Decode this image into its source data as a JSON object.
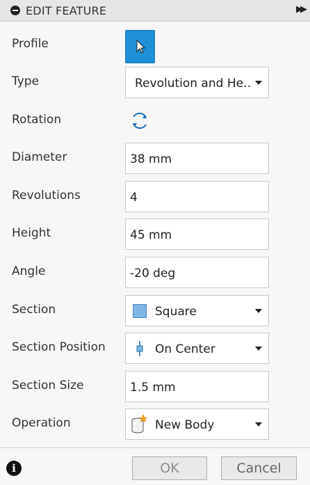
{
  "header": {
    "title": "EDIT FEATURE"
  },
  "fields": {
    "profile": {
      "label": "Profile"
    },
    "type": {
      "label": "Type",
      "value": "Revolution and He..."
    },
    "rotation": {
      "label": "Rotation"
    },
    "diameter": {
      "label": "Diameter",
      "value": "38 mm"
    },
    "revolutions": {
      "label": "Revolutions",
      "value": "4"
    },
    "height": {
      "label": "Height",
      "value": "45 mm"
    },
    "angle": {
      "label": "Angle",
      "value": "-20 deg"
    },
    "section": {
      "label": "Section",
      "value": "Square"
    },
    "section_position": {
      "label": "Section Position",
      "value": "On Center"
    },
    "section_size": {
      "label": "Section Size",
      "value": "1.5 mm"
    },
    "operation": {
      "label": "Operation",
      "value": "New Body"
    }
  },
  "footer": {
    "ok_label": "OK",
    "cancel_label": "Cancel"
  },
  "colors": {
    "accent": "#1f8fd6",
    "square_fill": "#7fb6e6",
    "new_body_star": "#f5a623"
  },
  "icons": [
    "collapse-icon",
    "expand-panel-icon",
    "cursor-arrow-icon",
    "rotation-icon",
    "square-icon",
    "section-position-icon",
    "new-body-icon",
    "info-icon"
  ]
}
